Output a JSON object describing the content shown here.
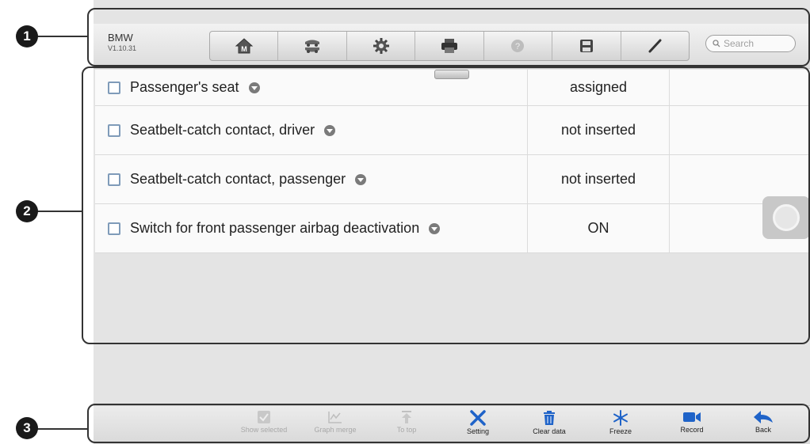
{
  "header": {
    "brand": "BMW",
    "version": "V1.10.31",
    "tools": [
      "home-icon",
      "vehicle-swap-icon",
      "settings-icon",
      "print-icon",
      "help-icon",
      "save-icon",
      "pen-icon"
    ],
    "search_placeholder": "Search"
  },
  "table": {
    "rows": [
      {
        "name": "Passenger's seat",
        "value": "assigned"
      },
      {
        "name": "Seatbelt-catch contact, driver",
        "value": "not inserted"
      },
      {
        "name": "Seatbelt-catch contact, passenger",
        "value": "not inserted"
      },
      {
        "name": "Switch for front passenger airbag deactivation",
        "value": "ON"
      }
    ]
  },
  "bottom": {
    "buttons": [
      {
        "label": "Show selected",
        "icon": "checkbox-icon",
        "enabled": false
      },
      {
        "label": "Graph merge",
        "icon": "graph-icon",
        "enabled": false
      },
      {
        "label": "To top",
        "icon": "to-top-icon",
        "enabled": false
      },
      {
        "label": "Setting",
        "icon": "wrench-icon",
        "enabled": true
      },
      {
        "label": "Clear data",
        "icon": "trash-icon",
        "enabled": true
      },
      {
        "label": "Freeze",
        "icon": "snowflake-icon",
        "enabled": true
      },
      {
        "label": "Record",
        "icon": "camera-icon",
        "enabled": true
      },
      {
        "label": "Back",
        "icon": "back-arrow-icon",
        "enabled": true
      }
    ]
  },
  "callouts": [
    "1",
    "2",
    "3"
  ],
  "colors": {
    "accent": "#1f63c8",
    "disabled": "#a8a8a8",
    "callout": "#1a1a1a"
  }
}
